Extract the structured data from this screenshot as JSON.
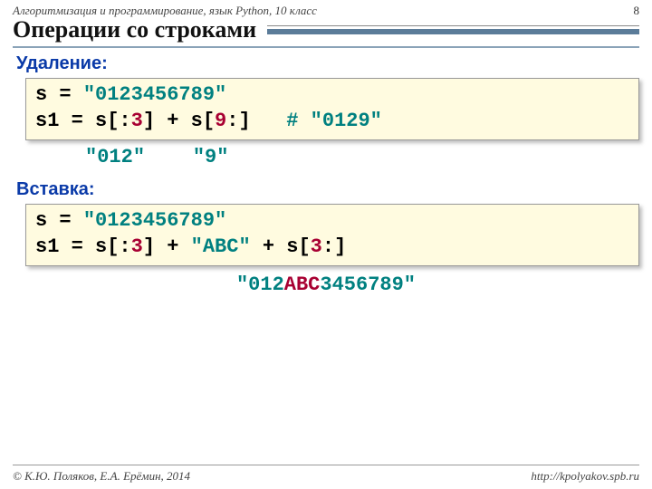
{
  "header": {
    "course": "Алгоритмизация и программирование, язык Python, 10 класс",
    "page": "8",
    "title": "Операции со строками"
  },
  "sections": {
    "delete_label": "Удаление:",
    "delete_code": {
      "l1_a": "s = ",
      "l1_b": "\"0123456789\"",
      "l2_a": "s1 = s[:",
      "l2_b": "3",
      "l2_c": "] + s[",
      "l2_d": "9",
      "l2_e": ":]   ",
      "l2_f": "# \"0129\""
    },
    "delete_annot": "     \"012\"    \"9\"",
    "insert_label": "Вставка:",
    "insert_code": {
      "l1_a": "s = ",
      "l1_b": "\"0123456789\"",
      "l2_a": "s1 = s[:",
      "l2_b": "3",
      "l2_c": "] + ",
      "l2_d": "\"ABC\"",
      "l2_e": " + s[",
      "l2_f": "3",
      "l2_g": ":]"
    },
    "insert_result_a": "\"012",
    "insert_result_b": "ABC",
    "insert_result_c": "3456789\""
  },
  "footer": {
    "left": "© К.Ю. Поляков, Е.А. Ерёмин, 2014",
    "right": "http://kpolyakov.spb.ru"
  }
}
